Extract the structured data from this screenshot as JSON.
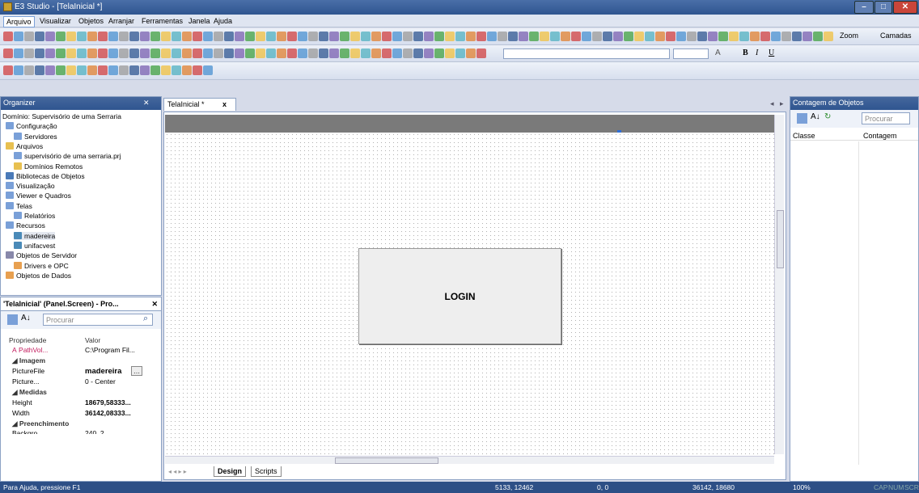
{
  "title": "E3 Studio - [TelaInicial *]",
  "menu": [
    "Arquivo",
    "Visualizar",
    "Objetos",
    "Arranjar",
    "Ferramentas",
    "Janela",
    "Ajuda"
  ],
  "toolbar": {
    "zoom": "Zoom",
    "layers": "Camadas",
    "bold": "B",
    "italic": "I",
    "underline": "U",
    "text_color": "A"
  },
  "organizer": {
    "title": "Organizer",
    "pin": "☧",
    "close": "✕",
    "items": [
      "Domínio: Supervisório de uma Serraria",
      "Configuração",
      "Servidores",
      "Arquivos",
      "supervisório de uma serraria.prj",
      "Domínios Remotos",
      "Bibliotecas de Objetos",
      "Visualização",
      "Viewer e Quadros",
      "Telas",
      "Relatórios",
      "Recursos",
      "madereira",
      "unifacvest",
      "Objetos de Servidor",
      "Drivers e OPC",
      "Objetos de Dados"
    ]
  },
  "props": {
    "title": "'TelaInicial' (Panel.Screen) - Pro...",
    "search": "Procurar",
    "col_prop": "Propriedade",
    "col_val": "Valor",
    "g_image": "Imagem",
    "g_measures": "Medidas",
    "g_fill": "Preenchimento",
    "pathvol": "PathVol...",
    "pathvol_val": "C:\\Program Fil...",
    "picfile": "PictureFile",
    "picfile_val": "madereira",
    "picpos": "Picture...",
    "picpos_val": "0 - Center",
    "height": "Height",
    "height_val": "18679,58333...",
    "width": "Width",
    "width_val": "36142,08333...",
    "backg": "Backgro...",
    "backg_val": "240, 2"
  },
  "doc": {
    "tab": "TelaInicial *",
    "close": "x",
    "login": "LOGIN",
    "design": "Design",
    "scripts": "Scripts"
  },
  "counter": {
    "title": "Contagem de Objetos",
    "search": "Procurar",
    "col_class": "Classe",
    "col_count": "Contagem"
  },
  "status": {
    "help": "Para Ajuda, pressione F1",
    "pos": "5133, 12462",
    "size": "0, 0",
    "dim": "36142, 18680",
    "zoom": "100%",
    "cap": "CAP",
    "num": "NUM",
    "scr": "SCR"
  }
}
